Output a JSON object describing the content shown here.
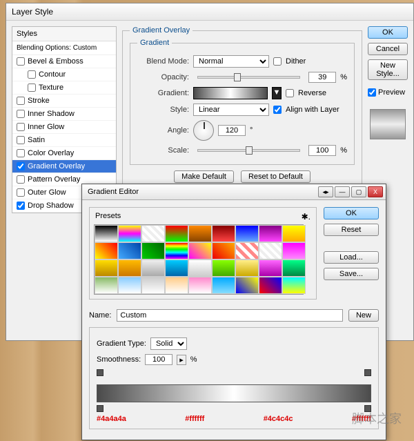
{
  "layerStyle": {
    "title": "Layer Style",
    "stylesHeader": "Styles",
    "blendingOptions": "Blending Options: Custom",
    "items": [
      {
        "label": "Bevel & Emboss",
        "checked": false,
        "indent": false
      },
      {
        "label": "Contour",
        "checked": false,
        "indent": true
      },
      {
        "label": "Texture",
        "checked": false,
        "indent": true
      },
      {
        "label": "Stroke",
        "checked": false,
        "indent": false
      },
      {
        "label": "Inner Shadow",
        "checked": false,
        "indent": false
      },
      {
        "label": "Inner Glow",
        "checked": false,
        "indent": false
      },
      {
        "label": "Satin",
        "checked": false,
        "indent": false
      },
      {
        "label": "Color Overlay",
        "checked": false,
        "indent": false
      },
      {
        "label": "Gradient Overlay",
        "checked": true,
        "indent": false,
        "selected": true
      },
      {
        "label": "Pattern Overlay",
        "checked": false,
        "indent": false
      },
      {
        "label": "Outer Glow",
        "checked": false,
        "indent": false
      },
      {
        "label": "Drop Shadow",
        "checked": true,
        "indent": false
      }
    ],
    "panel": {
      "legend": "Gradient Overlay",
      "subLegend": "Gradient",
      "blendModeLabel": "Blend Mode:",
      "blendMode": "Normal",
      "ditherLabel": "Dither",
      "opacityLabel": "Opacity:",
      "opacity": "39",
      "pct": "%",
      "gradientLabel": "Gradient:",
      "reverseLabel": "Reverse",
      "styleLabel": "Style:",
      "style": "Linear",
      "alignLabel": "Align with Layer",
      "angleLabel": "Angle:",
      "angle": "120",
      "deg": "°",
      "scaleLabel": "Scale:",
      "scale": "100",
      "makeDefault": "Make Default",
      "resetDefault": "Reset to Default"
    },
    "right": {
      "ok": "OK",
      "cancel": "Cancel",
      "newStyle": "New Style...",
      "preview": "Preview"
    }
  },
  "gradientEditor": {
    "title": "Gradient Editor",
    "presets": "Presets",
    "ok": "OK",
    "reset": "Reset",
    "load": "Load...",
    "save": "Save...",
    "nameLabel": "Name:",
    "name": "Custom",
    "new": "New",
    "typeLabel": "Gradient Type:",
    "type": "Solid",
    "smoothLabel": "Smoothness:",
    "smooth": "100",
    "pct": "%",
    "hexes": [
      "#4a4a4a",
      "#ffffff",
      "#4c4c4c",
      "#ffffff"
    ],
    "swatches": [
      "linear-gradient(#000,#fff)",
      "linear-gradient(#ff0,#f0f,#0ff)",
      "repeating-linear-gradient(45deg,#eee 0 4px,#fff 4px 8px)",
      "linear-gradient(#f00,#0f0)",
      "linear-gradient(#f80,#840)",
      "linear-gradient(#800,#f44)",
      "linear-gradient(#00f,#6af)",
      "linear-gradient(#808,#f4f)",
      "linear-gradient(#ff0,#fa0)",
      "linear-gradient(45deg,#ff0,#f00)",
      "linear-gradient(45deg,#4af,#04a)",
      "linear-gradient(45deg,#0c0,#060)",
      "linear-gradient(#f00,#ff0,#0f0,#0ff,#00f,#f0f)",
      "linear-gradient(45deg,#f0f,#ff0)",
      "linear-gradient(45deg,#e00,#fa0)",
      "repeating-linear-gradient(45deg,#f88 0 5px,#fff 5px 10px)",
      "repeating-linear-gradient(45deg,#eee 0 4px,#fff 4px 8px)",
      "linear-gradient(#f0f,#f8f)",
      "linear-gradient(#fd0,#b80)",
      "linear-gradient(#fb0,#c70)",
      "linear-gradient(#eee,#aaa)",
      "linear-gradient(#0cf,#06a)",
      "linear-gradient(#fff,#ccc)",
      "linear-gradient(#8f0,#4a0)",
      "linear-gradient(#fe8,#ca0)",
      "linear-gradient(#f6f,#a0a)",
      "linear-gradient(#0f8,#084)",
      "linear-gradient(#8b6,#fff)",
      "linear-gradient(#8cf,#fff)",
      "linear-gradient(#ccc,#fff)",
      "linear-gradient(#fc8,#fff)",
      "linear-gradient(#f8c,#fff)",
      "linear-gradient(#0af,#8df)",
      "linear-gradient(45deg,#00f,#ff0)",
      "linear-gradient(45deg,#f00,#00f)",
      "linear-gradient(#0ff,#ff0)"
    ]
  },
  "watermark": "脚本之家"
}
